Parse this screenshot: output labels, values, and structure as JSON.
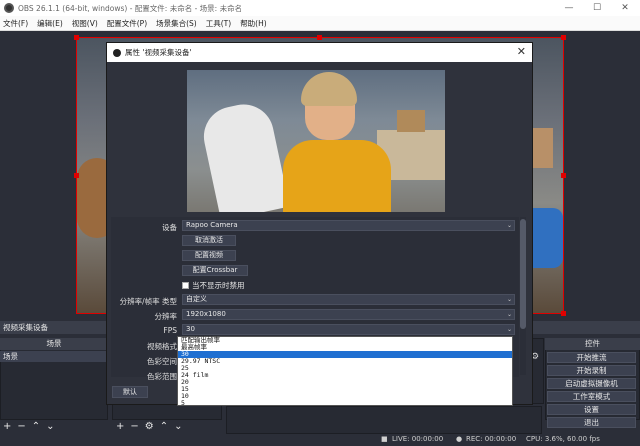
{
  "window": {
    "title": "OBS 26.1.1 (64-bit, windows) - 配置文件: 未命名 - 场景: 未命名"
  },
  "menu": [
    "文件(F)",
    "编辑(E)",
    "视图(V)",
    "配置文件(P)",
    "场景集合(S)",
    "工具(T)",
    "帮助(H)"
  ],
  "source_dock": {
    "title": "视频采集设备"
  },
  "scenes": {
    "header": "场景",
    "items": [
      "场景"
    ]
  },
  "controls": {
    "header": "控件",
    "buttons": [
      "开始推流",
      "开始录制",
      "启动虚拟摄像机",
      "工作室模式",
      "设置",
      "退出"
    ]
  },
  "status": {
    "live": "LIVE: 00:00:00",
    "rec": "REC: 00:00:00",
    "cpu": "CPU: 3.6%, 60.00 fps"
  },
  "dialog": {
    "title": "属性 '视频采集设备'",
    "device_label": "设备",
    "device_value": "Rapoo Camera",
    "btn_deactivate": "取消激活",
    "btn_config_video": "配置视频",
    "btn_config_crossbar": "配置Crossbar",
    "checkbox_label": "当不显示时禁用",
    "res_type_label": "分辨率/帧率 类型",
    "res_type_value": "自定义",
    "resolution_label": "分辨率",
    "resolution_value": "1920x1080",
    "fps_label": "FPS",
    "fps_value": "30",
    "video_format_label": "视频格式",
    "color_space_label": "色彩空间",
    "color_range_label": "色彩范围",
    "defaults_button": "默认",
    "fps_options": [
      "匹配输出帧率",
      "最高帧率",
      "30",
      "29.97 NTSC",
      "25",
      "24 film",
      "20",
      "15",
      "10",
      "5"
    ],
    "fps_selected_index": 2
  },
  "icons": {
    "close": "close-icon",
    "minimize": "minimize-icon",
    "maximize": "maximize-icon",
    "add": "plus-icon",
    "remove": "minus-icon",
    "up": "chevron-up-icon",
    "down": "chevron-down-icon",
    "gear": "gear-icon"
  }
}
